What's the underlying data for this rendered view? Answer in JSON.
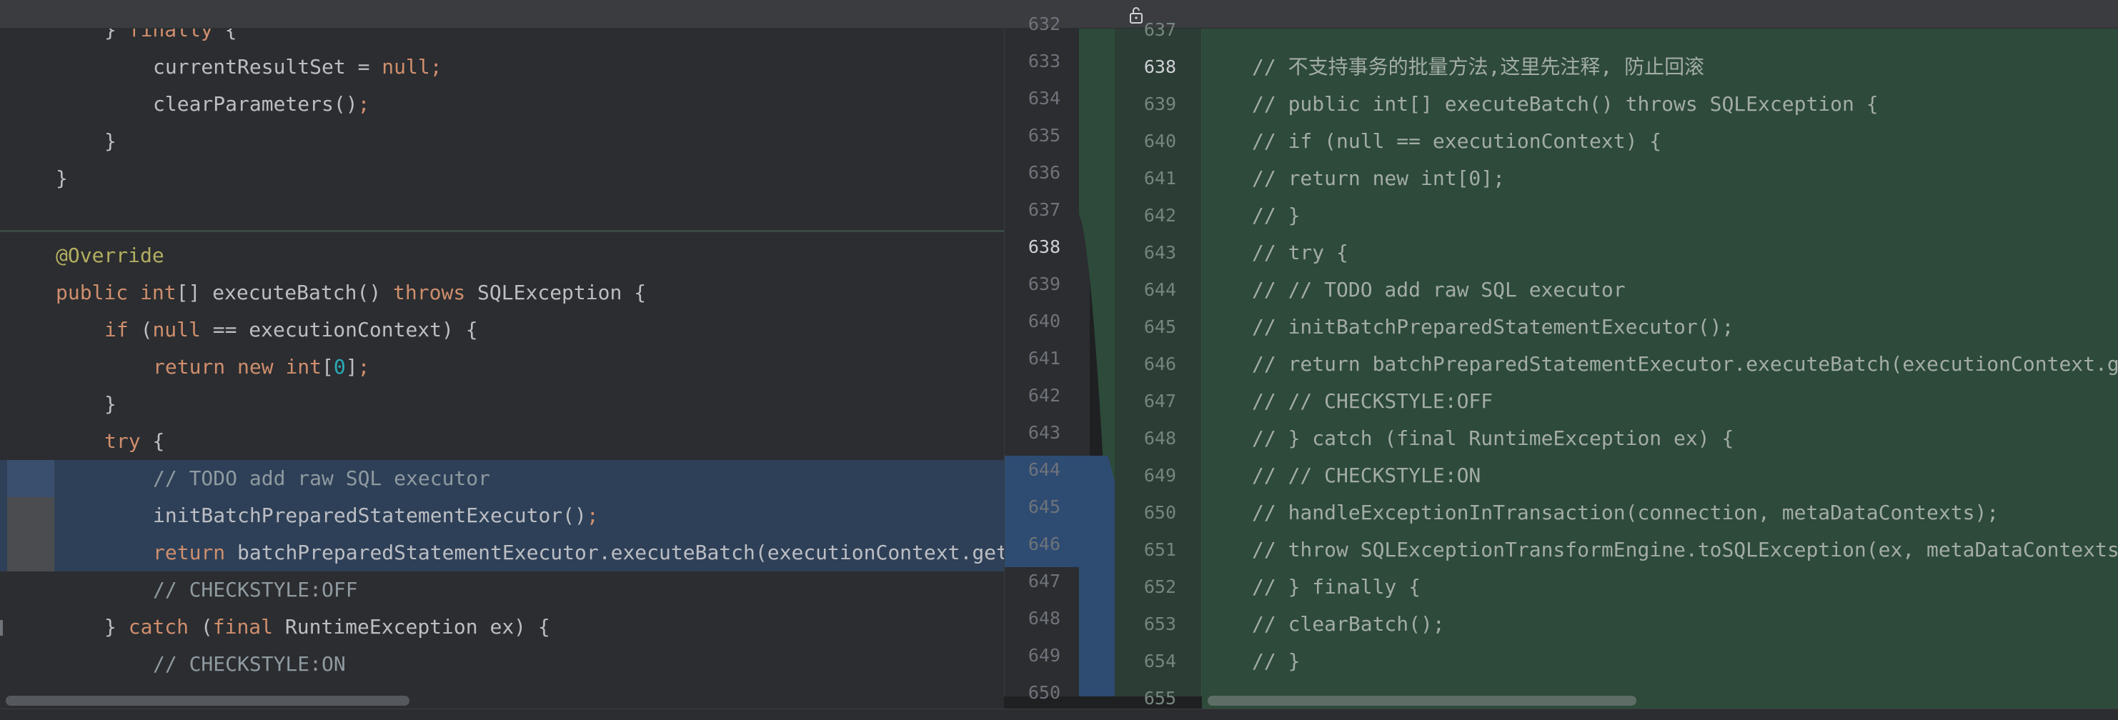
{
  "colors": {
    "keyword": "#cf8e6d",
    "number": "#2aacb8",
    "annotation": "#b3ae60",
    "comment": "#8f9aa1",
    "default_text": "#bcbec4",
    "modified_bg": "#2e4057",
    "added_bg": "#2d4a3a"
  },
  "icons": {
    "lock": "lock-icon"
  },
  "left": {
    "lines": [
      {
        "indent": 2,
        "tokens": [
          {
            "t": "} ",
            "c": "def"
          },
          {
            "t": "finally",
            "c": "kw"
          },
          {
            "t": " {",
            "c": "def"
          }
        ]
      },
      {
        "indent": 3,
        "tokens": [
          {
            "t": "currentResultSet = ",
            "c": "def"
          },
          {
            "t": "null",
            "c": "kw"
          },
          {
            "t": ";",
            "c": "kw"
          }
        ]
      },
      {
        "indent": 3,
        "tokens": [
          {
            "t": "clearParameters()",
            "c": "def"
          },
          {
            "t": ";",
            "c": "kw"
          }
        ]
      },
      {
        "indent": 2,
        "tokens": [
          {
            "t": "}",
            "c": "def"
          }
        ]
      },
      {
        "indent": 1,
        "tokens": [
          {
            "t": "}",
            "c": "def"
          }
        ]
      },
      {
        "indent": 0,
        "tokens": []
      },
      {
        "indent": 1,
        "tokens": [
          {
            "t": "@Override",
            "c": "ann"
          }
        ]
      },
      {
        "indent": 1,
        "tokens": [
          {
            "t": "public ",
            "c": "kw"
          },
          {
            "t": "int",
            "c": "kw"
          },
          {
            "t": "[] executeBatch() ",
            "c": "def"
          },
          {
            "t": "throws ",
            "c": "kw"
          },
          {
            "t": "SQLException {",
            "c": "def"
          }
        ]
      },
      {
        "indent": 2,
        "tokens": [
          {
            "t": "if ",
            "c": "kw"
          },
          {
            "t": "(",
            "c": "def"
          },
          {
            "t": "null",
            "c": "kw"
          },
          {
            "t": " == executionContext) {",
            "c": "def"
          }
        ]
      },
      {
        "indent": 3,
        "tokens": [
          {
            "t": "return ",
            "c": "kw"
          },
          {
            "t": "new ",
            "c": "kw"
          },
          {
            "t": "int",
            "c": "kw"
          },
          {
            "t": "[",
            "c": "def"
          },
          {
            "t": "0",
            "c": "num"
          },
          {
            "t": "]",
            "c": "def"
          },
          {
            "t": ";",
            "c": "kw"
          }
        ]
      },
      {
        "indent": 2,
        "tokens": [
          {
            "t": "}",
            "c": "def"
          }
        ]
      },
      {
        "indent": 2,
        "tokens": [
          {
            "t": "try ",
            "c": "kw"
          },
          {
            "t": "{",
            "c": "def"
          }
        ]
      },
      {
        "indent": 3,
        "modified": true,
        "mark": "blue",
        "tokens": [
          {
            "t": "// TODO add raw SQL executor",
            "c": "cmt"
          }
        ]
      },
      {
        "indent": 3,
        "modified": true,
        "mark": "gray",
        "tokens": [
          {
            "t": "initBatchPreparedStatementExecutor()",
            "c": "def"
          },
          {
            "t": ";",
            "c": "kw"
          }
        ]
      },
      {
        "indent": 3,
        "modified": true,
        "mark": "gray",
        "tokens": [
          {
            "t": "return ",
            "c": "kw"
          },
          {
            "t": "batchPreparedStatementExecutor.executeBatch(executionContext.get",
            "c": "def"
          }
        ]
      },
      {
        "indent": 3,
        "tokens": [
          {
            "t": "// CHECKSTYLE:OFF",
            "c": "cmt"
          }
        ]
      },
      {
        "indent": 2,
        "tokens": [
          {
            "t": "} ",
            "c": "def"
          },
          {
            "t": "catch ",
            "c": "kw"
          },
          {
            "t": "(",
            "c": "def"
          },
          {
            "t": "final ",
            "c": "kw"
          },
          {
            "t": "RuntimeException ex) {",
            "c": "def"
          }
        ]
      },
      {
        "indent": 3,
        "tokens": [
          {
            "t": "// CHECKSTYLE:ON",
            "c": "cmt"
          }
        ]
      }
    ]
  },
  "gutter_left": {
    "numbers": [
      "632",
      "633",
      "634",
      "635",
      "636",
      "637",
      "638",
      "639",
      "640",
      "641",
      "642",
      "643",
      "644",
      "645",
      "646",
      "647",
      "648",
      "649",
      "650"
    ],
    "current": "638"
  },
  "gutter_right": {
    "numbers": [
      "637",
      "638",
      "639",
      "640",
      "641",
      "642",
      "643",
      "644",
      "645",
      "646",
      "647",
      "648",
      "649",
      "650",
      "651",
      "652",
      "653",
      "654",
      "655"
    ],
    "current": "638"
  },
  "right": {
    "lines": [
      "",
      "// 不支持事务的批量方法,这里先注释, 防止回滚",
      "// public int[] executeBatch() throws SQLException {",
      "// if (null == executionContext) {",
      "// return new int[0];",
      "// }",
      "// try {",
      "// // TODO add raw SQL executor",
      "// initBatchPreparedStatementExecutor();",
      "// return batchPreparedStatementExecutor.executeBatch(executionContext.ge",
      "// // CHECKSTYLE:OFF",
      "// } catch (final RuntimeException ex) {",
      "// // CHECKSTYLE:ON",
      "// handleExceptionInTransaction(connection, metaDataContexts);",
      "// throw SQLExceptionTransformEngine.toSQLException(ex, metaDataContexts",
      "// } finally {",
      "// clearBatch();",
      "// }",
      ""
    ]
  }
}
